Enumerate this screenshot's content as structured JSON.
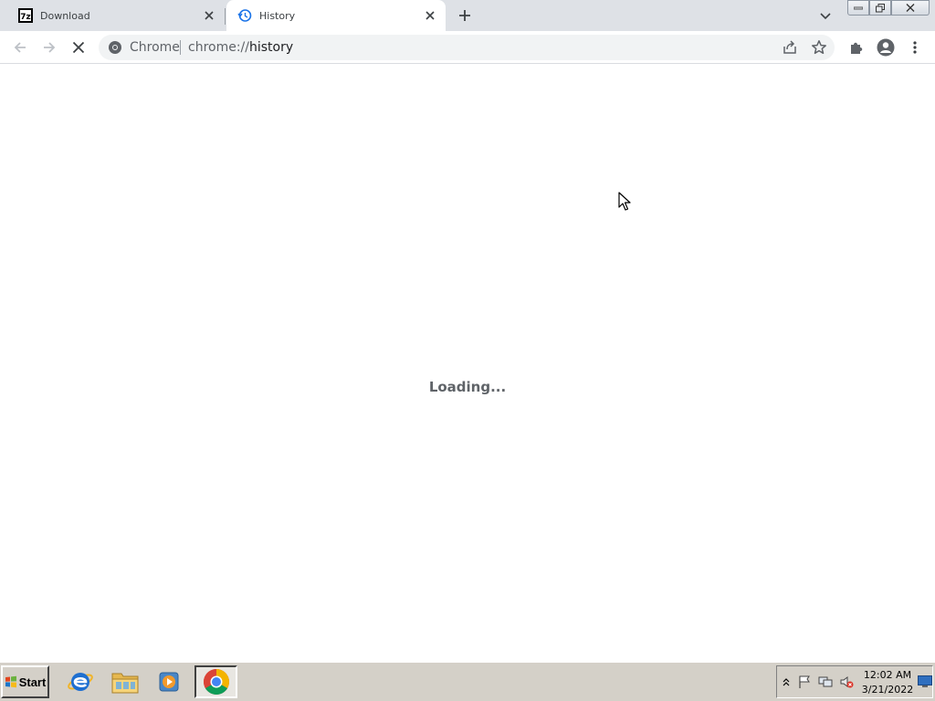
{
  "browser": {
    "tabs": [
      {
        "title": "Download",
        "favicon": "7zip-icon",
        "active": false
      },
      {
        "title": "History",
        "favicon": "history-icon",
        "active": true
      }
    ],
    "omnibox": {
      "chip_label": "Chrome",
      "url_scheme": "chrome://",
      "url_host": "history"
    }
  },
  "content": {
    "loading_text": "Loading..."
  },
  "taskbar": {
    "start_label": "Start",
    "apps": [
      "internet-explorer",
      "file-explorer",
      "media-player",
      "chrome"
    ],
    "clock": {
      "time": "12:02 AM",
      "date": "3/21/2022"
    }
  },
  "colors": {
    "tabstrip_bg": "#dee1e6",
    "omnibox_bg": "#f1f3f4",
    "taskbar_bg": "#d4d0c8",
    "loading_text": "#5f6368"
  }
}
